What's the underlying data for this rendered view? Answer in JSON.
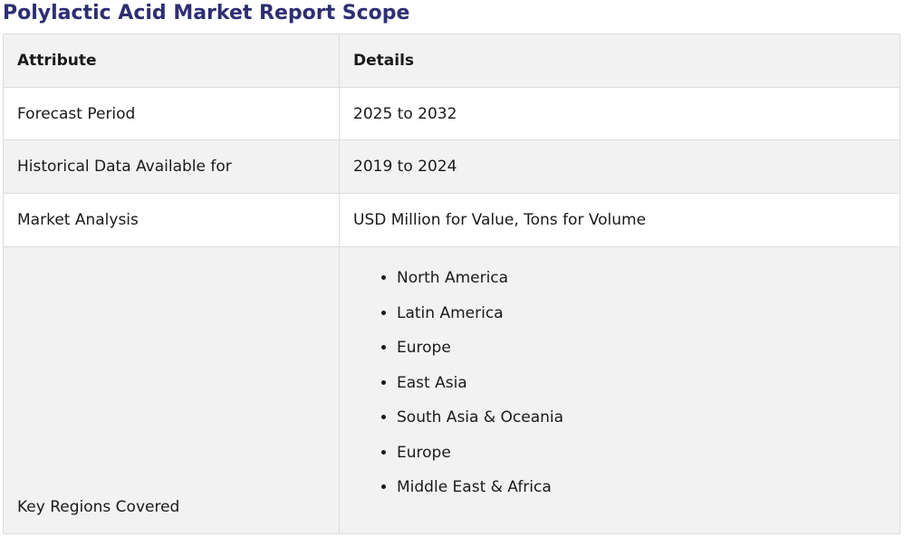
{
  "title": "Polylactic Acid Market Report Scope",
  "table": {
    "headers": [
      "Attribute",
      "Details"
    ],
    "rows": [
      {
        "attribute": "Forecast Period",
        "details": "2025 to 2032"
      },
      {
        "attribute": "Historical Data Available for",
        "details": "2019 to 2024"
      },
      {
        "attribute": "Market Analysis",
        "details": "USD Million for Value, Tons for Volume"
      }
    ],
    "regions_row": {
      "attribute": "Key Regions Covered",
      "regions": [
        "North America",
        "Latin America",
        "Europe",
        "East Asia",
        "South Asia & Oceania",
        "Europe",
        "Middle East & Africa"
      ]
    }
  },
  "colors": {
    "title": "#2e2e73",
    "row_shade": "#f2f2f2",
    "border": "#dddddd"
  }
}
